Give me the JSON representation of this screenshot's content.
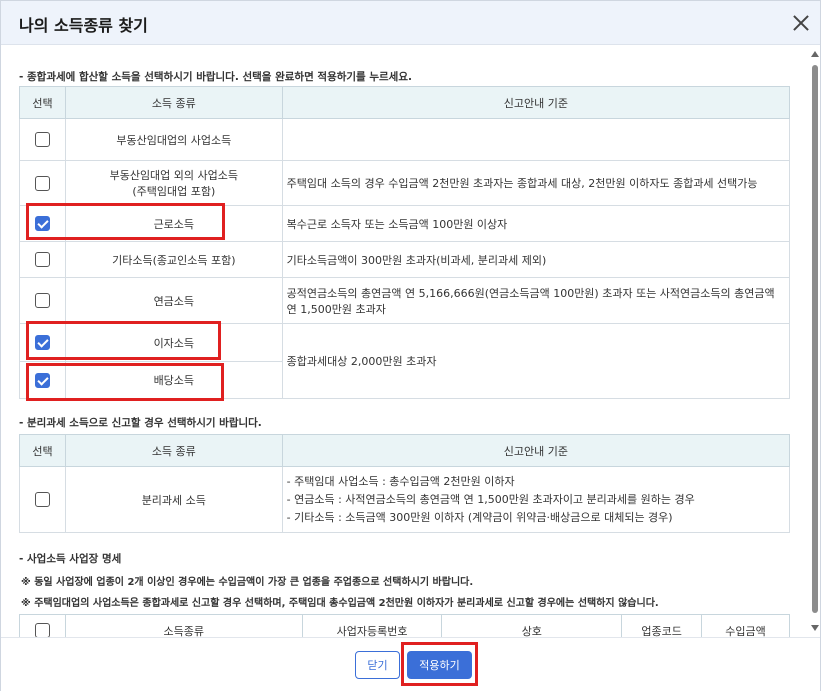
{
  "modal": {
    "title": "나의 소득종류 찾기"
  },
  "section1": {
    "note": "- 종합과세에 합산할 소득을 선택하시기 바랍니다. 선택을 완료하면 적용하기를 누르세요.",
    "headers": [
      "선택",
      "소득 종류",
      "신고안내 기준"
    ],
    "rows": [
      {
        "type": "부동산임대업의 사업소득",
        "type2": "",
        "guide": "",
        "guide2": "",
        "checked": false
      },
      {
        "type": "부동산임대업 외의 사업소득",
        "type2": "(주택임대업 포함)",
        "guide": "주택임대 소득의 경우 수입금액 2천만원 초과자는 종합과세 대상, 2천만원 이하자도 종합과세 선택가능",
        "guide2": "",
        "checked": false
      },
      {
        "type": "근로소득",
        "type2": "",
        "guide": "복수근로 소득자 또는 소득금액 100만원 이상자",
        "guide2": "",
        "checked": true
      },
      {
        "type": "기타소득(종교인소득 포함)",
        "type2": "",
        "guide": "기타소득금액이 300만원 초과자(비과세, 분리과세 제외)",
        "guide2": "",
        "checked": false
      },
      {
        "type": "연금소득",
        "type2": "",
        "guide": "공적연금소득의 총연금액 연 5,166,666원(연금소득금액 100만원) 초과자 또는 사적연금소득의 총연금액",
        "guide2": "연 1,500만원 초과자",
        "checked": false
      },
      {
        "type": "이자소득",
        "type2": "",
        "guide": "종합과세대상 2,000만원 초과자",
        "guide2": "",
        "checked": true
      },
      {
        "type": "배당소득",
        "type2": "",
        "guide": "",
        "guide2": "",
        "checked": true
      }
    ]
  },
  "section2": {
    "note": "- 분리과세 소득으로 신고할 경우 선택하시기 바랍니다.",
    "headers": [
      "선택",
      "소득 종류",
      "신고안내 기준"
    ],
    "row": {
      "type": "분리과세 소득",
      "checked": false,
      "lines": [
        "- 주택임대 사업소득 : 총수입금액 2천만원 이하자",
        "- 연금소득 : 사적연금소득의 총연금액 연 1,500만원 초과자이고 분리과세를 원하는 경우",
        "- 기타소득 : 소득금액 300만원 이하자 (계약금이 위약금·배상금으로 대체되는 경우)"
      ]
    }
  },
  "section3": {
    "note": "- 사업소득 사업장 명세",
    "sub1": "※ 동일 사업장에 업종이 2개 이상인 경우에는 수입금액이 가장 큰 업종을 주업종으로 선택하시기 바랍니다.",
    "sub2": "※ 주택임대업의 사업소득은 종합과세로 신고할 경우 선택하며, 주택임대 총수입금액 2천만원 이하자가 분리과세로 신고할 경우에는 선택하지 않습니다.",
    "headers": [
      "소득종류",
      "사업자등록번호",
      "상호",
      "업종코드",
      "수입금액"
    ]
  },
  "footer": {
    "close_label": "닫기",
    "apply_label": "적용하기"
  },
  "colors": {
    "accent": "#3b6fd8",
    "highlight": "#e02020",
    "header_bg": "#eef3fb",
    "table_head_bg": "#eaf4f6"
  }
}
